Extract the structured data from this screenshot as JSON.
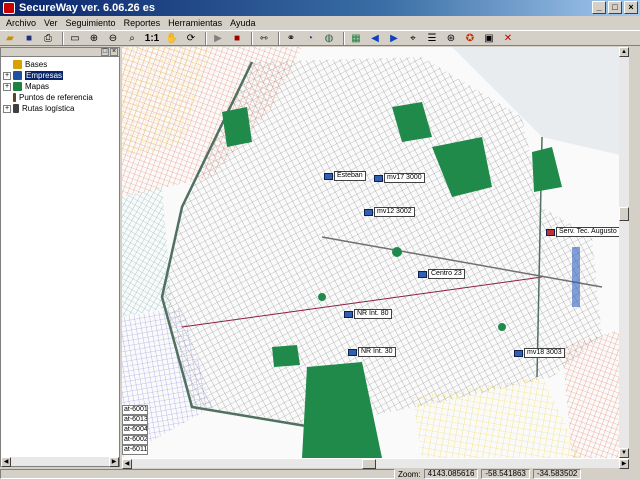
{
  "window": {
    "title": "SecureWay ver. 6.06.26 es",
    "buttons": [
      "_",
      "□",
      "×"
    ]
  },
  "menu": [
    "Archivo",
    "Ver",
    "Seguimiento",
    "Reportes",
    "Herramientas",
    "Ayuda"
  ],
  "toolbar": {
    "icons": [
      "open-folder-icon",
      "save-icon",
      "print-icon",
      "window-icon",
      "zoom-in-icon",
      "zoom-out-icon",
      "zoom-fit-icon"
    ],
    "one_to_one": "1:1",
    "icons2": [
      "pan-hand-icon",
      "refresh-icon",
      "play-icon",
      "stop-icon",
      "measure-icon",
      "binoculars-icon",
      "clock-icon",
      "globe-icon",
      "map-icon",
      "arrow-left-icon",
      "arrow-right-icon",
      "crosshair-icon",
      "list-icon",
      "network-icon",
      "satellite-icon",
      "picture-icon",
      "remove-icon"
    ]
  },
  "tree": {
    "items": [
      {
        "label": "Bases",
        "expand": "",
        "color": "#d8a000"
      },
      {
        "label": "Empresas",
        "expand": "+",
        "color": "#2050a0",
        "selected": true
      },
      {
        "label": "Mapas",
        "expand": "+",
        "color": "#208040"
      },
      {
        "label": "Puntos de referencia",
        "expand": "",
        "color": "#604020"
      },
      {
        "label": "Rutas logística",
        "expand": "+",
        "color": "#404040"
      }
    ]
  },
  "map": {
    "markers": [
      {
        "label": "Esteban"
      },
      {
        "label": "mv17 3000"
      },
      {
        "label": "mv12 3002"
      },
      {
        "label": "Serv. Tec. Augusto"
      },
      {
        "label": "Centro 23"
      },
      {
        "label": "NR Int. 80"
      },
      {
        "label": "NR Int. 30"
      },
      {
        "label": "mv18 3003"
      }
    ],
    "side_list": [
      "at-6001",
      "at-6013",
      "at-6004",
      "at-6002",
      "at-6011"
    ]
  },
  "statusbar": {
    "zoom_label": "Zoom:",
    "zoom_value": "4143.085616",
    "lon": "-58.541863",
    "lat": "-34.583502"
  }
}
